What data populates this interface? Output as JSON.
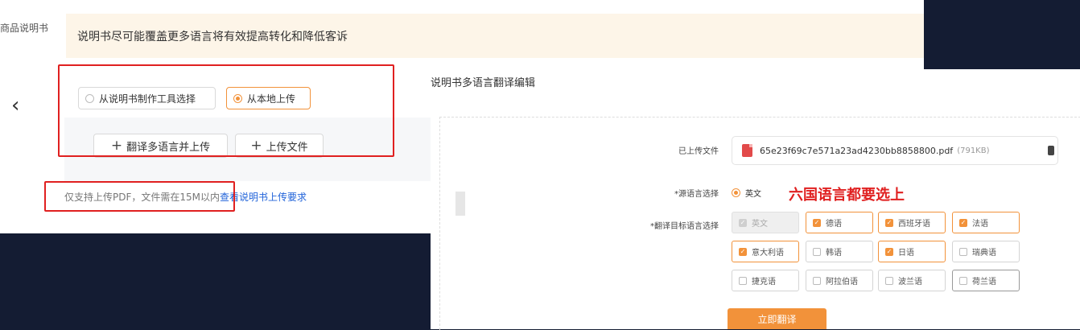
{
  "page": {
    "side_label": "商品说明书",
    "notice": "说明书尽可能覆盖更多语言将有效提高转化和降低客诉",
    "back_icon": "chevron-left-icon",
    "upload_options": [
      {
        "label": "从说明书制作工具选择",
        "selected": false
      },
      {
        "label": "从本地上传",
        "selected": true
      }
    ],
    "buttons": {
      "translate_upload": "翻译多语言并上传",
      "upload_file": "上传文件"
    },
    "hint_text": "仅支持上传PDF，文件需在15M以内",
    "hint_link": "查看说明书上传要求"
  },
  "dialog": {
    "title": "说明书多语言翻译编辑",
    "uploaded_label": "已上传文件",
    "file_name": "65e23f69c7e571a23ad4230bb8858800.pdf",
    "file_size": "(791KB)",
    "source_label": "*源语言选择",
    "source_value": "英文",
    "annotation": "六国语言都要选上",
    "target_label": "*翻译目标语言选择",
    "languages": [
      {
        "label": "英文",
        "checked": true,
        "disabled": true
      },
      {
        "label": "德语",
        "checked": true,
        "disabled": false
      },
      {
        "label": "西班牙语",
        "checked": true,
        "disabled": false
      },
      {
        "label": "法语",
        "checked": true,
        "disabled": false
      },
      {
        "label": "意大利语",
        "checked": true,
        "disabled": false
      },
      {
        "label": "韩语",
        "checked": false,
        "disabled": false
      },
      {
        "label": "日语",
        "checked": true,
        "disabled": false
      },
      {
        "label": "瑞典语",
        "checked": false,
        "disabled": false
      },
      {
        "label": "捷克语",
        "checked": false,
        "disabled": false
      },
      {
        "label": "阿拉伯语",
        "checked": false,
        "disabled": false
      },
      {
        "label": "波兰语",
        "checked": false,
        "disabled": false
      },
      {
        "label": "荷兰语",
        "checked": false,
        "disabled": false
      }
    ],
    "submit_label": "立即翻译"
  },
  "colors": {
    "accent": "#f2923a",
    "annotation_red": "#e02020",
    "link": "#1f62d9",
    "dark_bg": "#141c33"
  }
}
